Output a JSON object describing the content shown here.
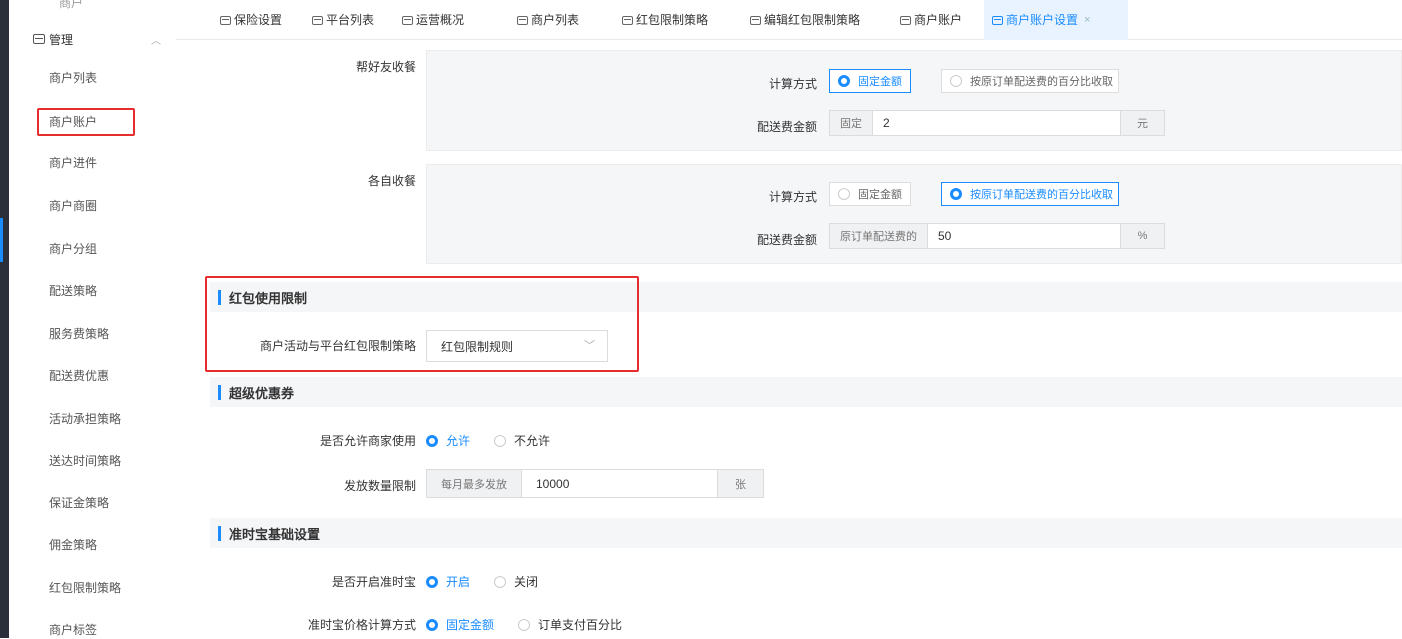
{
  "sidebar": {
    "top_label": "商户",
    "group_label": "管理",
    "items": [
      {
        "label": "商户列表"
      },
      {
        "label": "商户账户"
      },
      {
        "label": "商户进件"
      },
      {
        "label": "商户商圈"
      },
      {
        "label": "商户分组"
      },
      {
        "label": "配送策略"
      },
      {
        "label": "服务费策略"
      },
      {
        "label": "配送费优惠"
      },
      {
        "label": "活动承担策略"
      },
      {
        "label": "送达时间策略"
      },
      {
        "label": "保证金策略"
      },
      {
        "label": "佣金策略"
      },
      {
        "label": "红包限制策略"
      },
      {
        "label": "商户标签"
      }
    ]
  },
  "tabs": [
    {
      "label": "保险设置"
    },
    {
      "label": "平台列表"
    },
    {
      "label": "运营概况"
    },
    {
      "label": "商户列表"
    },
    {
      "label": "红包限制策略"
    },
    {
      "label": "编辑红包限制策略"
    },
    {
      "label": "商户账户"
    },
    {
      "label": "商户账户设置"
    }
  ],
  "tab_close": "×",
  "delivery": {
    "friend": {
      "label": "帮好友收餐",
      "calc_label": "计算方式",
      "option_fixed": "固定金额",
      "option_percent": "按原订单配送费的百分比收取",
      "selected": "fixed",
      "fee_label": "配送费金额",
      "prefix": "固定",
      "value": "2",
      "suffix": "元"
    },
    "self": {
      "label": "各自收餐",
      "calc_label": "计算方式",
      "option_fixed": "固定金额",
      "option_percent": "按原订单配送费的百分比收取",
      "selected": "percent",
      "fee_label": "配送费金额",
      "prefix": "原订单配送费的",
      "value": "50",
      "suffix": "%"
    }
  },
  "redpacket": {
    "title": "红包使用限制",
    "label": "商户活动与平台红包限制策略",
    "value": "红包限制规则"
  },
  "coupon": {
    "title": "超级优惠券",
    "allow_label": "是否允许商家使用",
    "allow_yes": "允许",
    "allow_no": "不允许",
    "limit_label": "发放数量限制",
    "limit_prefix": "每月最多发放",
    "limit_value": "10000",
    "limit_suffix": "张"
  },
  "ontime": {
    "title": "准时宝基础设置",
    "enable_label": "是否开启准时宝",
    "enable_yes": "开启",
    "enable_no": "关闭",
    "calc_label": "准时宝价格计算方式",
    "calc_fixed": "固定金额",
    "calc_percent": "订单支付百分比"
  },
  "colors": {
    "accent": "#1a8cff",
    "highlight": "#e52d2d"
  }
}
